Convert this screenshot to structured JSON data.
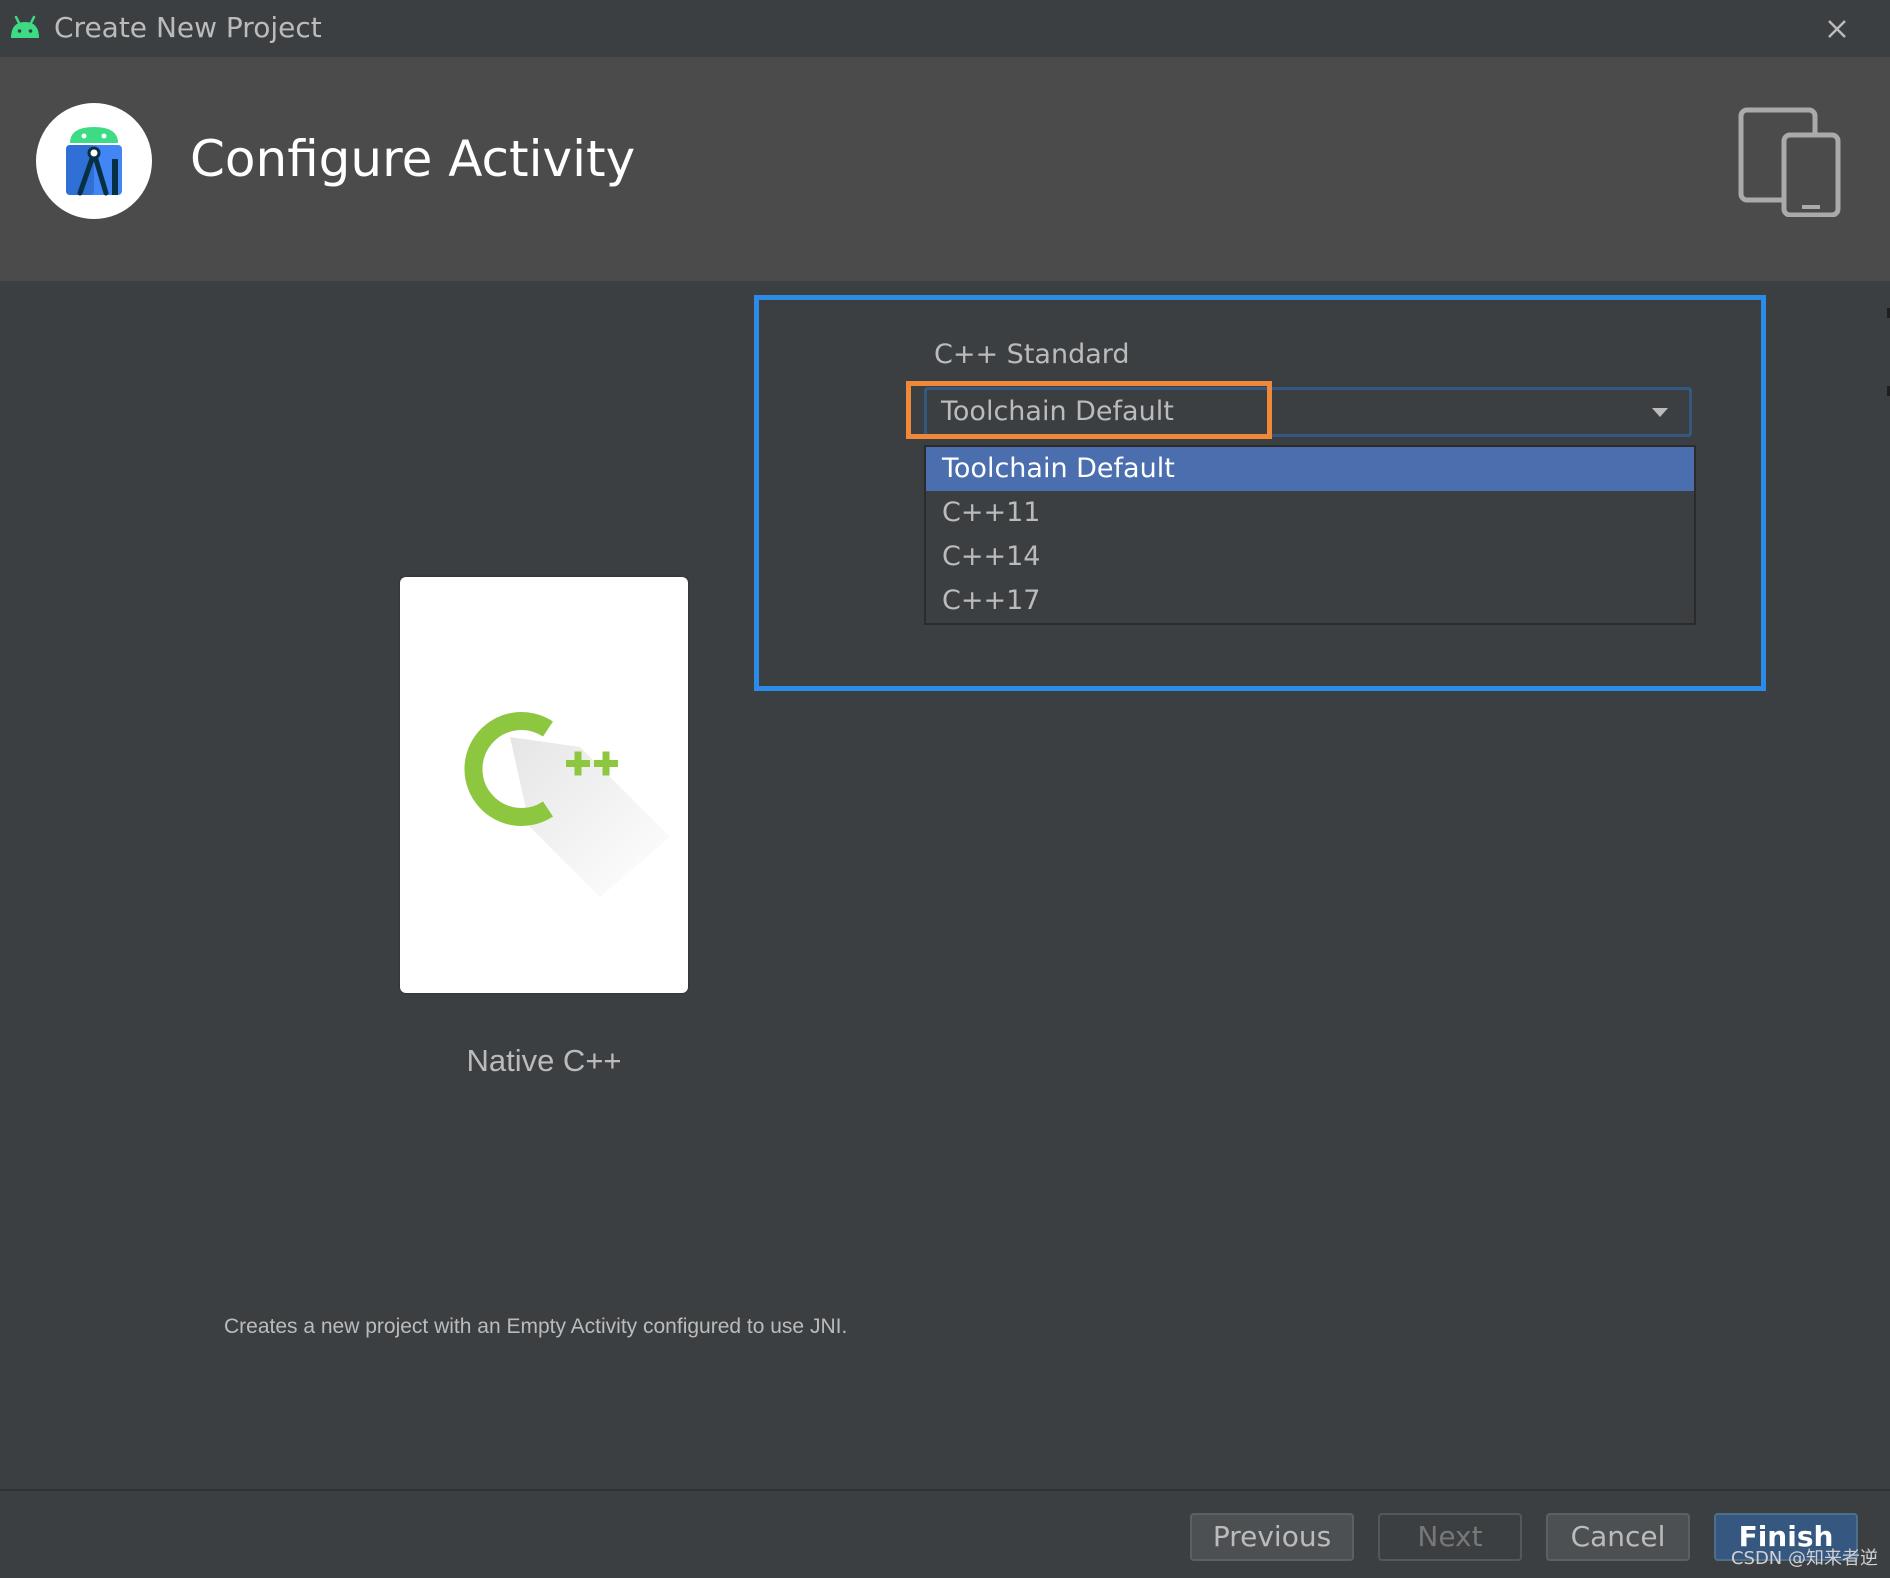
{
  "window": {
    "title": "Create New Project",
    "close_icon": "close-icon"
  },
  "header": {
    "title": "Configure Activity"
  },
  "template": {
    "name": "Native C++",
    "description": "Creates a new project with an Empty Activity configured to use JNI."
  },
  "cpp_standard": {
    "label": "C++ Standard",
    "selected": "Toolchain Default",
    "options": [
      "Toolchain Default",
      "C++11",
      "C++14",
      "C++17"
    ],
    "selected_index": 0
  },
  "footer": {
    "previous_label": "Previous",
    "next_label": "Next",
    "cancel_label": "Cancel",
    "finish_label": "Finish"
  },
  "watermark": "CSDN @知来者逆",
  "colors": {
    "highlight_blue": "#2b8be6",
    "highlight_orange": "#f0883a",
    "selection": "#4b6eaf",
    "cpp_green": "#8dc63f"
  }
}
